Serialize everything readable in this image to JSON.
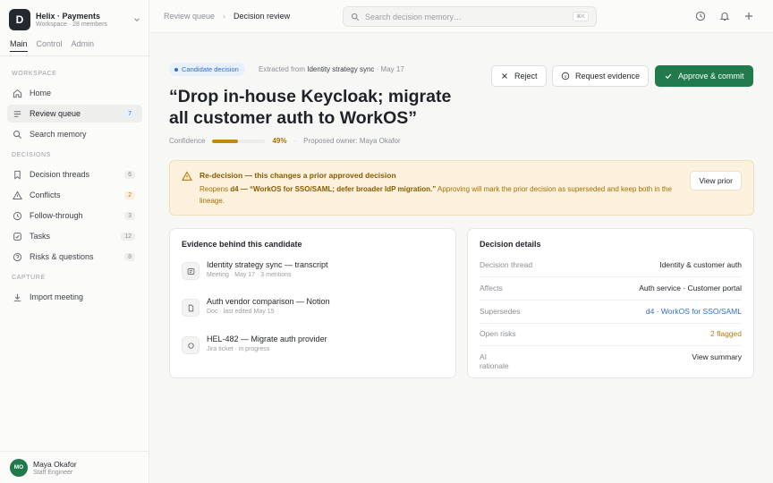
{
  "workspace": {
    "initial": "D",
    "name": "Helix · Payments",
    "sub": "Workspace · 28 members"
  },
  "mode_tabs": [
    "Main",
    "Control",
    "Admin"
  ],
  "sidebar": {
    "section_workspace": "WORKSPACE",
    "home": "Home",
    "review_queue": {
      "label": "Review queue",
      "count": "7"
    },
    "search_memory": "Search memory",
    "section_decisions": "DECISIONS",
    "decision_threads": {
      "label": "Decision threads",
      "count": "6"
    },
    "conflicts": {
      "label": "Conflicts",
      "count": "2"
    },
    "follow_through": {
      "label": "Follow-through",
      "count": "3"
    },
    "tasks": {
      "label": "Tasks",
      "count": "12"
    },
    "risks": {
      "label": "Risks & questions",
      "count": "8"
    },
    "section_capture": "CAPTURE",
    "import_meeting": "Import meeting"
  },
  "user": {
    "initials": "MO",
    "name": "Maya Okafor",
    "role": "Staff Engineer"
  },
  "topbar": {
    "crumb1": "Review queue",
    "crumb_sep": "›",
    "crumb2": "Decision review",
    "search_placeholder": "Search decision memory…",
    "search_kbd": "⌘K"
  },
  "candidate": {
    "badge": "Candidate decision",
    "extracted_prefix": "Extracted from",
    "extracted_source": "Identity strategy sync",
    "extracted_date": "· May 17",
    "title": "“Drop in-house Keycloak; migrate all customer auth to WorkOS”",
    "confidence_label": "Confidence",
    "confidence_value": 0.49,
    "confidence_pct": "49%",
    "owner": "Proposed owner: Maya Okafor"
  },
  "actions": {
    "reject": "Reject",
    "request": "Request evidence",
    "approve": "Approve & commit"
  },
  "warning": {
    "title": "Re-decision — this changes a prior approved decision",
    "prefix": "Reopens",
    "ref": "d4 — “WorkOS for SSO/SAML; defer broader IdP migration.”",
    "body": "Approving will mark the prior decision as superseded and keep both in the lineage.",
    "button": "View prior"
  },
  "evidence": {
    "title": "Evidence behind this candidate",
    "items": [
      {
        "title": "Identity strategy sync — transcript",
        "meta": "Meeting · May 17 · 3 mentions"
      },
      {
        "title": "Auth vendor comparison — Notion",
        "meta": "Doc · last edited May 15"
      },
      {
        "title": "HEL-482 — Migrate auth provider",
        "meta": "Jira ticket · in progress"
      }
    ]
  },
  "details": {
    "title": "Decision details",
    "rows": [
      {
        "key": "Decision thread",
        "value": "Identity & customer auth"
      },
      {
        "key": "Affects",
        "value": "Auth service · Customer portal"
      },
      {
        "key": "Supersedes",
        "value": "d4 · WorkOS for SSO/SAML"
      },
      {
        "key": "Open risks",
        "value": "2 flagged"
      },
      {
        "key": "AI rationale",
        "value": "View summary"
      }
    ]
  },
  "colors": {
    "accent": "#217a4c",
    "link": "#2f6fd1",
    "warning": "#b97a0c"
  }
}
